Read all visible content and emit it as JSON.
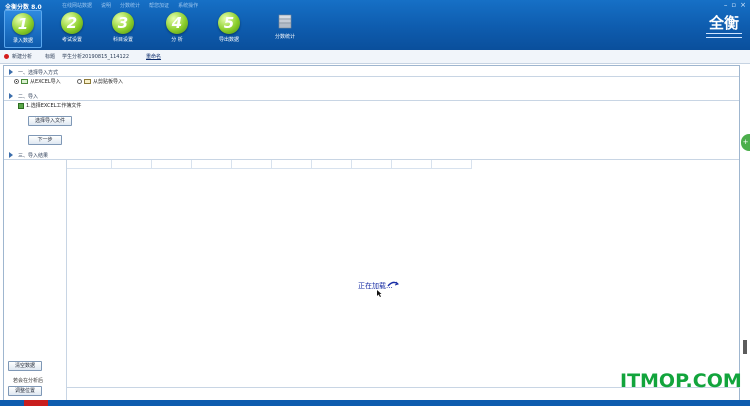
{
  "app": {
    "title": "全衡分数 8.0",
    "menu": [
      "在线网站数据",
      "说明",
      "分数统计",
      "帮您加证",
      "系统操作"
    ],
    "window_controls": [
      "–",
      "▫",
      "×"
    ]
  },
  "toolbar": [
    {
      "num": "1",
      "label": "录入数据",
      "active": true
    },
    {
      "num": "2",
      "label": "考试设置",
      "active": false
    },
    {
      "num": "3",
      "label": "科目设置",
      "active": false
    },
    {
      "num": "4",
      "label": "分  析",
      "active": false
    },
    {
      "num": "5",
      "label": "导出数据",
      "active": false
    },
    {
      "num": "",
      "label": "分数统计",
      "active": false
    }
  ],
  "logo": {
    "text": "全衡"
  },
  "breadcrumb": {
    "item1": "新建分析",
    "item2": "标题",
    "item3": "学生分析20190815_114122",
    "rename": "重命名"
  },
  "section1": {
    "title": "一、选择导入方式",
    "option_excel": "从EXCEL导入",
    "option_clipboard": "从剪贴板导入"
  },
  "section2": {
    "title": "二、导入",
    "file_label": "1.选择EXCEL工作簿文件",
    "choose_button": "选择导入文件",
    "next_button": "下一步"
  },
  "section3": {
    "title": "三、导入结果",
    "loading_text": "正在加载..."
  },
  "left": {
    "clear_button": "清空数据",
    "note": "若会在分析后",
    "adjust_button": "调整位置"
  },
  "right_pin": "+",
  "watermark": "ITMOP.COM",
  "colors": {
    "header": "#0e5cae",
    "accent_green": "#8ccf2c",
    "status_red": "#c81e1e",
    "loading_text": "#1a2fa5"
  }
}
